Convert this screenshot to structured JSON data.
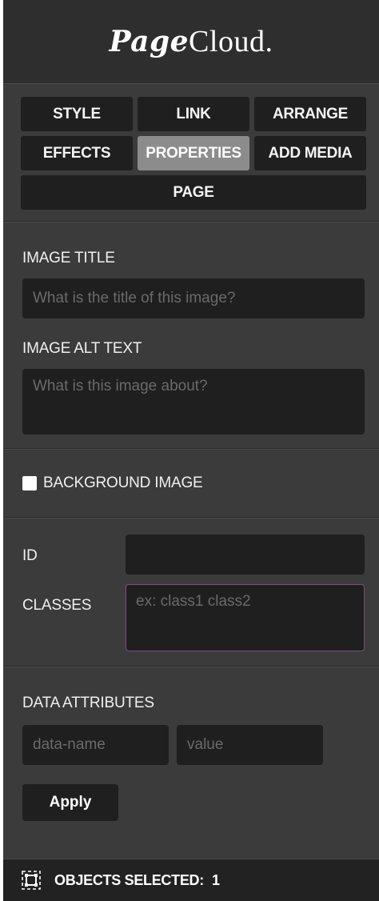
{
  "header": {
    "logo_script": "Page",
    "logo_serif": "Cloud."
  },
  "tabs": {
    "row1": [
      "STYLE",
      "LINK",
      "ARRANGE"
    ],
    "row2": [
      "EFFECTS",
      "PROPERTIES",
      "ADD MEDIA"
    ],
    "row3": [
      "PAGE"
    ],
    "active": "PROPERTIES"
  },
  "image": {
    "title_label": "IMAGE TITLE",
    "title_placeholder": "What is the title of this image?",
    "title_value": "",
    "alt_label": "IMAGE ALT TEXT",
    "alt_placeholder": "What is this image about?",
    "alt_value": ""
  },
  "background": {
    "label": "BACKGROUND IMAGE",
    "checked": false
  },
  "identity": {
    "id_label": "ID",
    "id_value": "",
    "classes_label": "CLASSES",
    "classes_placeholder": "ex: class1 class2",
    "classes_value": ""
  },
  "data_attributes": {
    "label": "DATA ATTRIBUTES",
    "name_placeholder": "data-name",
    "value_placeholder": "value",
    "apply_label": "Apply"
  },
  "footer": {
    "label": "OBJECTS SELECTED:",
    "count": "1"
  },
  "colors": {
    "panel_bg": "#3b3b3b",
    "header_bg": "#2e2e2e",
    "button_bg": "#1f1f1f",
    "active_tab_bg": "#8c8c8c",
    "focus_border": "#7e4f7a"
  }
}
